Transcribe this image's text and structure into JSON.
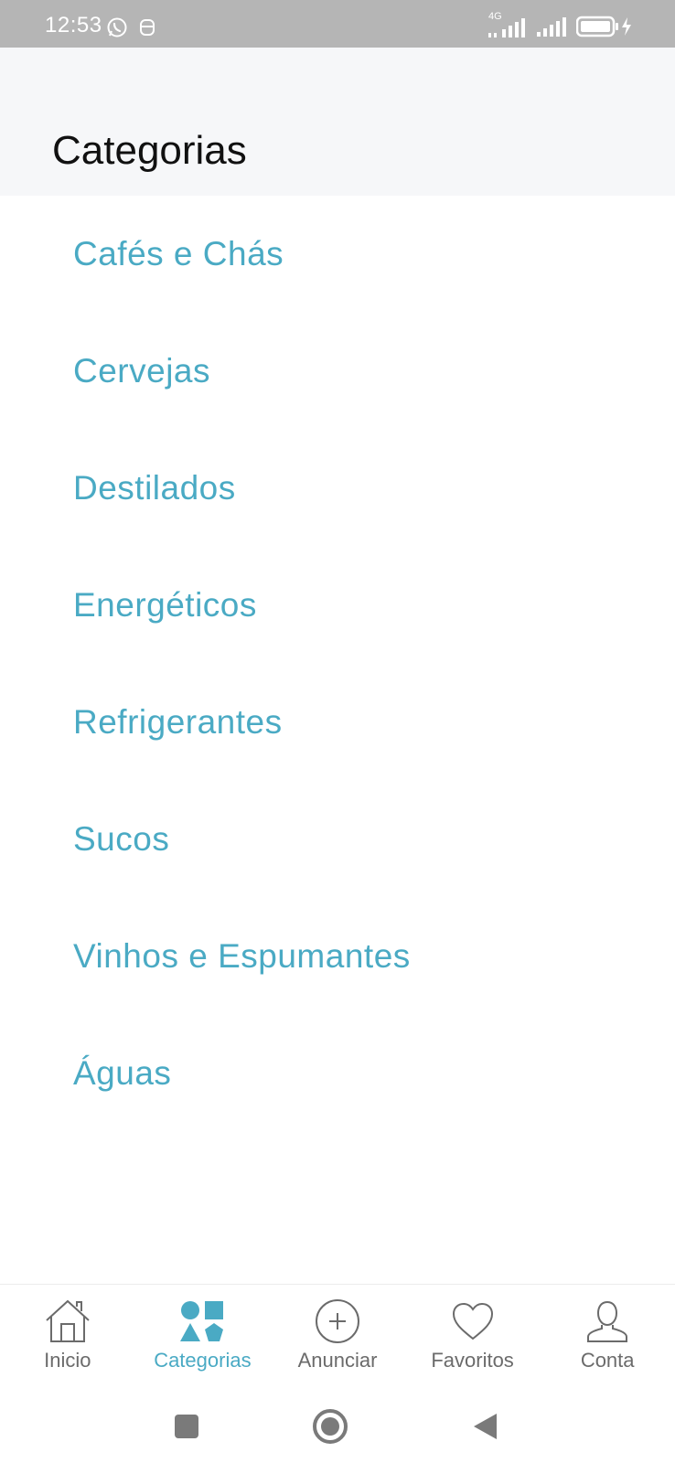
{
  "status_bar": {
    "time": "12:53",
    "network": "4G"
  },
  "header": {
    "title": "Categorias"
  },
  "categories": [
    {
      "label": "Cafés e Chás"
    },
    {
      "label": "Cervejas"
    },
    {
      "label": "Destilados"
    },
    {
      "label": "Energéticos"
    },
    {
      "label": "Refrigerantes"
    },
    {
      "label": "Sucos"
    },
    {
      "label": "Vinhos e Espumantes"
    },
    {
      "label": "Águas"
    }
  ],
  "bottom_nav": {
    "active": "categorias",
    "items": [
      {
        "label": "Inicio",
        "icon": "home-icon"
      },
      {
        "label": "Categorias",
        "icon": "shapes-icon"
      },
      {
        "label": "Anunciar",
        "icon": "plus-circle-icon"
      },
      {
        "label": "Favoritos",
        "icon": "heart-icon"
      },
      {
        "label": "Conta",
        "icon": "user-icon"
      }
    ]
  },
  "colors": {
    "accent": "#4aaac4",
    "status_bar": "#b5b5b5",
    "header_bg": "#f6f7f9",
    "inactive": "#6b6b6b"
  }
}
